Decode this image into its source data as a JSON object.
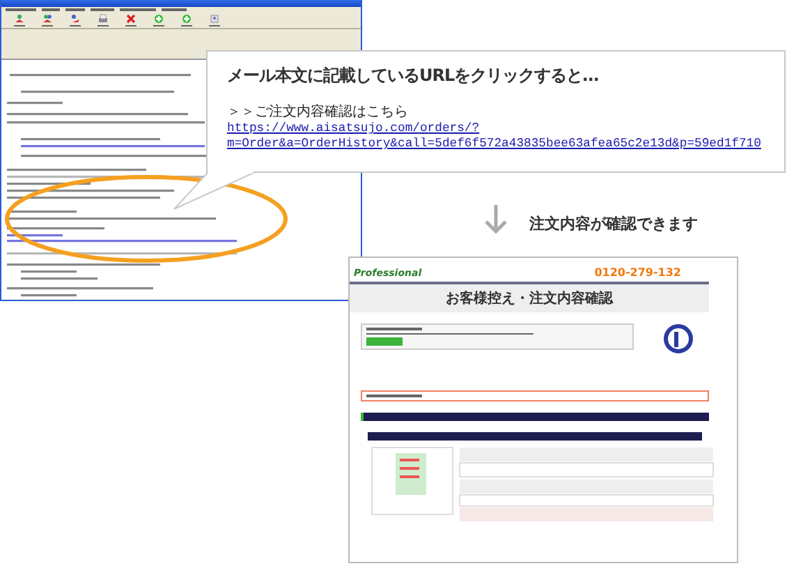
{
  "callout": {
    "heading": "メール本文に記載しているURLをクリックすると…",
    "link_label": "＞＞ご注文内容確認はこちら",
    "url_lines": [
      "https://www.aisatsujo.com/orders/?",
      "m=Order&a=OrderHistory&call=5def6f572a43835bee63afea65c2e13d&p=59ed1f710"
    ]
  },
  "caption": "注文内容が確認できます",
  "order_page": {
    "brand": "Professional",
    "phone": "0120-279-132",
    "title": "お客様控え・注文内容確認"
  }
}
